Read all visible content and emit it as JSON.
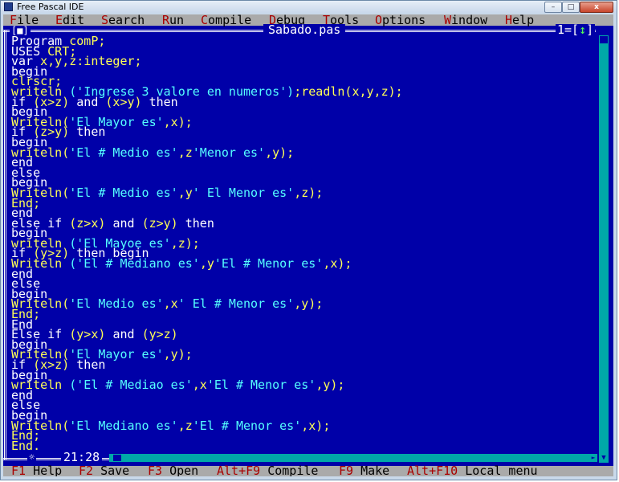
{
  "window": {
    "title": "Free Pascal IDE",
    "min_label": "–",
    "max_label": "□",
    "close_label": "x"
  },
  "menu": [
    {
      "hot": "F",
      "rest": "ile"
    },
    {
      "hot": "E",
      "rest": "dit"
    },
    {
      "hot": "S",
      "rest": "earch"
    },
    {
      "hot": "R",
      "rest": "un"
    },
    {
      "hot": "C",
      "rest": "ompile"
    },
    {
      "hot": "D",
      "rest": "ebug"
    },
    {
      "hot": "T",
      "rest": "ools"
    },
    {
      "hot": "O",
      "rest": "ptions"
    },
    {
      "hot": "W",
      "rest": "indow"
    },
    {
      "hot": "H",
      "rest": "elp"
    }
  ],
  "editor": {
    "file_name": "Sabado.pas",
    "close_box": "[■]",
    "window_number": "1=[",
    "zoom_arrow": "↕",
    "window_number_end": "]",
    "modified_marker": "☼",
    "cursor_pos": "21:28",
    "lines": [
      [
        [
          "w",
          "Program "
        ],
        [
          "y",
          "comP;"
        ]
      ],
      [
        [
          "w",
          "USES "
        ],
        [
          "y",
          "CRT;"
        ]
      ],
      [
        [
          "w",
          "var "
        ],
        [
          "y",
          "x,y,z:integer;"
        ]
      ],
      [
        [
          "w",
          "begin"
        ]
      ],
      [
        [
          "y",
          "clrscr;"
        ]
      ],
      [
        [
          "y",
          "writeln "
        ],
        [
          "c",
          "('Ingrese 3 valore en numeros')"
        ],
        [
          "y",
          ";readln(x,y,z);"
        ]
      ],
      [
        [
          "w",
          "if "
        ],
        [
          "y",
          "(x>z) "
        ],
        [
          "w",
          "and "
        ],
        [
          "y",
          "(x>y) "
        ],
        [
          "w",
          "then"
        ]
      ],
      [
        [
          "w",
          "begin"
        ]
      ],
      [
        [
          "y",
          "Writeln("
        ],
        [
          "c",
          "'El Mayor es'"
        ],
        [
          "y",
          ",x);"
        ]
      ],
      [
        [
          "w",
          "if "
        ],
        [
          "y",
          "(z>y) "
        ],
        [
          "w",
          "then"
        ]
      ],
      [
        [
          "w",
          "begin"
        ]
      ],
      [
        [
          "y",
          "writeln("
        ],
        [
          "c",
          "'El # Medio es'"
        ],
        [
          "y",
          ",z"
        ],
        [
          "c",
          "'Menor es'"
        ],
        [
          "y",
          ",y);"
        ]
      ],
      [
        [
          "w",
          "end"
        ]
      ],
      [
        [
          "w",
          "else"
        ]
      ],
      [
        [
          "w",
          "begin"
        ]
      ],
      [
        [
          "y",
          "Writeln("
        ],
        [
          "c",
          "'El # Medio es'"
        ],
        [
          "y",
          ",y"
        ],
        [
          "c",
          "' El Menor es'"
        ],
        [
          "y",
          ",z);"
        ]
      ],
      [
        [
          "y",
          "End;"
        ]
      ],
      [
        [
          "w",
          "end"
        ]
      ],
      [
        [
          "w",
          "else if "
        ],
        [
          "y",
          "(z>x) "
        ],
        [
          "w",
          "and "
        ],
        [
          "y",
          "(z>y) "
        ],
        [
          "w",
          "then"
        ]
      ],
      [
        [
          "w",
          "begin"
        ]
      ],
      [
        [
          "y",
          "writeln "
        ],
        [
          "c",
          "('El Mayoe es'"
        ],
        [
          "y",
          ",z);"
        ]
      ],
      [
        [
          "w",
          "if "
        ],
        [
          "y",
          "(y>z) "
        ],
        [
          "w",
          "then begin"
        ]
      ],
      [
        [
          "y",
          "Writeln "
        ],
        [
          "c",
          "('El # Mediano es'"
        ],
        [
          "y",
          ",y"
        ],
        [
          "c",
          "'El # Menor es'"
        ],
        [
          "y",
          ",x);"
        ]
      ],
      [
        [
          "w",
          "end"
        ]
      ],
      [
        [
          "w",
          "else"
        ]
      ],
      [
        [
          "w",
          "begin"
        ]
      ],
      [
        [
          "y",
          "Writeln("
        ],
        [
          "c",
          "'El Medio es'"
        ],
        [
          "y",
          ",x"
        ],
        [
          "c",
          "' El # Menor es'"
        ],
        [
          "y",
          ",y);"
        ]
      ],
      [
        [
          "y",
          "End;"
        ]
      ],
      [
        [
          "w",
          "End"
        ]
      ],
      [
        [
          "w",
          "Else if "
        ],
        [
          "y",
          "(y>x) "
        ],
        [
          "w",
          "and "
        ],
        [
          "y",
          "(y>z)"
        ]
      ],
      [
        [
          "w",
          "begin"
        ]
      ],
      [
        [
          "y",
          "Writeln("
        ],
        [
          "c",
          "'El Mayor es'"
        ],
        [
          "y",
          ",y);"
        ]
      ],
      [
        [
          "w",
          "if "
        ],
        [
          "y",
          "(x>z) "
        ],
        [
          "w",
          "then"
        ]
      ],
      [
        [
          "w",
          "begin"
        ]
      ],
      [
        [
          "y",
          "writeln "
        ],
        [
          "c",
          "('El # Mediao es'"
        ],
        [
          "y",
          ",x"
        ],
        [
          "c",
          "'El # Menor es'"
        ],
        [
          "y",
          ",y);"
        ]
      ],
      [
        [
          "w",
          "end"
        ]
      ],
      [
        [
          "w",
          "else"
        ]
      ],
      [
        [
          "w",
          "begin"
        ]
      ],
      [
        [
          "y",
          "Writeln("
        ],
        [
          "c",
          "'El Mediano es'"
        ],
        [
          "y",
          ",z"
        ],
        [
          "c",
          "'El # Menor es'"
        ],
        [
          "y",
          ",x);"
        ]
      ],
      [
        [
          "y",
          "End;"
        ]
      ],
      [
        [
          "y",
          "End."
        ]
      ]
    ]
  },
  "status": [
    {
      "key": "F1",
      "label": " Help"
    },
    {
      "key": "F2",
      "label": " Save"
    },
    {
      "key": "F3",
      "label": " Open"
    },
    {
      "key": "Alt+F9",
      "label": " Compile"
    },
    {
      "key": "F9",
      "label": " Make"
    },
    {
      "key": "Alt+F10",
      "label": " Local menu"
    }
  ],
  "colors": {
    "background": "#0000a8",
    "keyword": "#ffffff",
    "identifier": "#ffff55",
    "string": "#55ffff",
    "hotkey": "#a80000",
    "menubar": "#aaaaaa"
  }
}
